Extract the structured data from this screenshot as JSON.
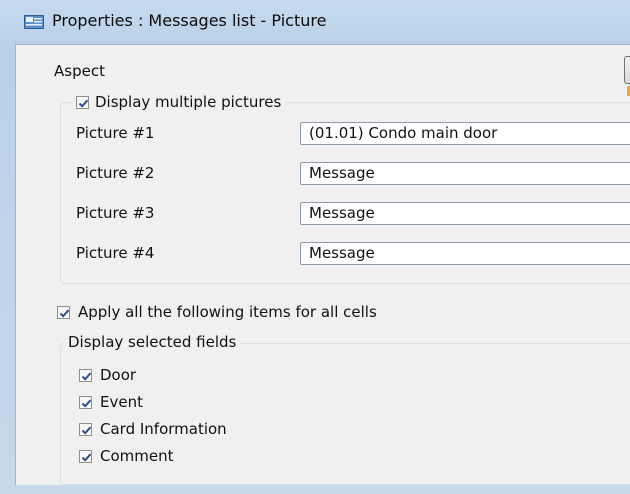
{
  "window": {
    "title": "Properties : Messages list - Picture",
    "icon": "properties-window-icon"
  },
  "aspect": {
    "label": "Aspect"
  },
  "pictures_group": {
    "legend": "Display multiple pictures",
    "checked": true,
    "rows": [
      {
        "label": "Picture #1",
        "value": "(01.01) Condo main door"
      },
      {
        "label": "Picture #2",
        "value": "Message"
      },
      {
        "label": "Picture #3",
        "value": "Message"
      },
      {
        "label": "Picture #4",
        "value": "Message"
      }
    ]
  },
  "apply_all": {
    "label": "Apply all the following items for all cells",
    "checked": true
  },
  "fields_group": {
    "legend": "Display selected fields",
    "items": [
      {
        "label": "Door",
        "checked": true
      },
      {
        "label": "Event",
        "checked": true
      },
      {
        "label": "Card Information",
        "checked": true
      },
      {
        "label": "Comment",
        "checked": true
      }
    ]
  },
  "colors": {
    "frame": "#b9d0e8",
    "client": "#f0f0f0",
    "check": "#2c4f8a",
    "combo_border": "#8d9aa8"
  }
}
